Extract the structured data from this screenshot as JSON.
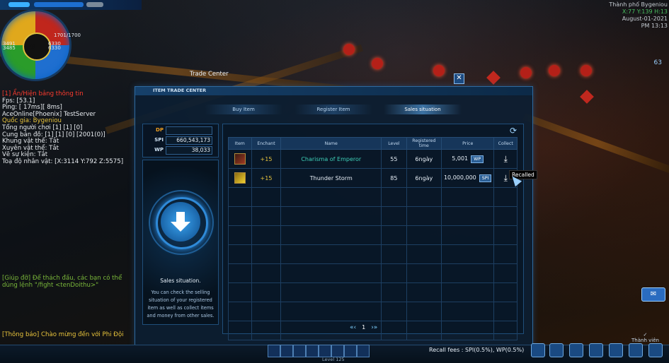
{
  "hud": {
    "gauge_values": [
      "1701/1700",
      "3491",
      "3485",
      "6330",
      "6330"
    ],
    "gauge_center": "0",
    "location": "Thành phố Bygeniou",
    "coords": "X:77 Y:139 H:13",
    "date": "August-01-2021",
    "time": "PM 13:13",
    "signal": "63"
  },
  "chat": [
    {
      "text": "[1] Ẩn/Hiện bảng thông tin",
      "color": "red"
    },
    {
      "text": "Fps: [53.1]",
      "color": "white"
    },
    {
      "text": "Ping: [ 17ms][ 8ms]",
      "color": "white"
    },
    {
      "text": "AceOnline[Phoenix] TestServer",
      "color": "white"
    },
    {
      "text": "Quốc gia: Bygeniou",
      "color": "yellow"
    },
    {
      "text": "Tổng người chơi [1] [1] [0]",
      "color": "white"
    },
    {
      "text": "Cung bản đồ: [1] [1] [0] [2001(0)]",
      "color": "white"
    },
    {
      "text": "Khung vật thể: Tắt",
      "color": "white"
    },
    {
      "text": "Xuyên vật thể: Tắt",
      "color": "white"
    },
    {
      "text": "Vẽ sự kiện: Tắt",
      "color": "white"
    },
    {
      "text": "Toạ độ nhân vật: [X:3114 Y:792 Z:5575]",
      "color": "white"
    }
  ],
  "chat_bottom": [
    {
      "text": "[Giúp đỡ] Để thách đấu, các bạn có thể",
      "color": "green"
    },
    {
      "text": "dùng lệnh \"/fight <tenDoithu>\"",
      "color": "green"
    }
  ],
  "notice": "[Thông báo] Chào mừng đến với Phi Đội",
  "trade": {
    "window_title": "Trade Center",
    "close_label": "✕",
    "header": "ITEM TRADE CENTER",
    "tabs": [
      {
        "label": "Buy Item",
        "active": false
      },
      {
        "label": "Register Item",
        "active": false
      },
      {
        "label": "Sales situation",
        "active": true
      }
    ],
    "currency": [
      {
        "label": "DP",
        "value": "",
        "color": "#f0a020"
      },
      {
        "label": "SPI",
        "value": "660,543,173",
        "color": "#cfe2f3"
      },
      {
        "label": "WP",
        "value": "38,033",
        "color": "#cfe2f3"
      }
    ],
    "info_title": "Sales situation.",
    "info_desc": "You can check the selling situation of your registered item as well as collect items and money from other sales.",
    "columns": [
      "Item",
      "Enchant",
      "Name",
      "Level",
      "Registered time",
      "Price",
      "Collect"
    ],
    "rows": [
      {
        "icon": "red-weapon-icon",
        "enchant": "+15",
        "name": "Charisma of Emperor",
        "name_color": "#3ecfb8",
        "level": "55",
        "time": "6ngày",
        "price": "5,001",
        "currency": "WP"
      },
      {
        "icon": "yellow-weapon-icon",
        "enchant": "+15",
        "name": "Thunder Storm",
        "name_color": "#e6eef6",
        "level": "85",
        "time": "6ngày",
        "price": "10,000,000",
        "currency": "SPI"
      }
    ],
    "empty_rows": 8,
    "tooltip": "Recalled",
    "page": "1",
    "recall_fees": "Recall fees : SPI(0.5%), WP(0.5%)"
  },
  "bottom": {
    "level": "Level 125",
    "support_label": "Thành viên"
  }
}
